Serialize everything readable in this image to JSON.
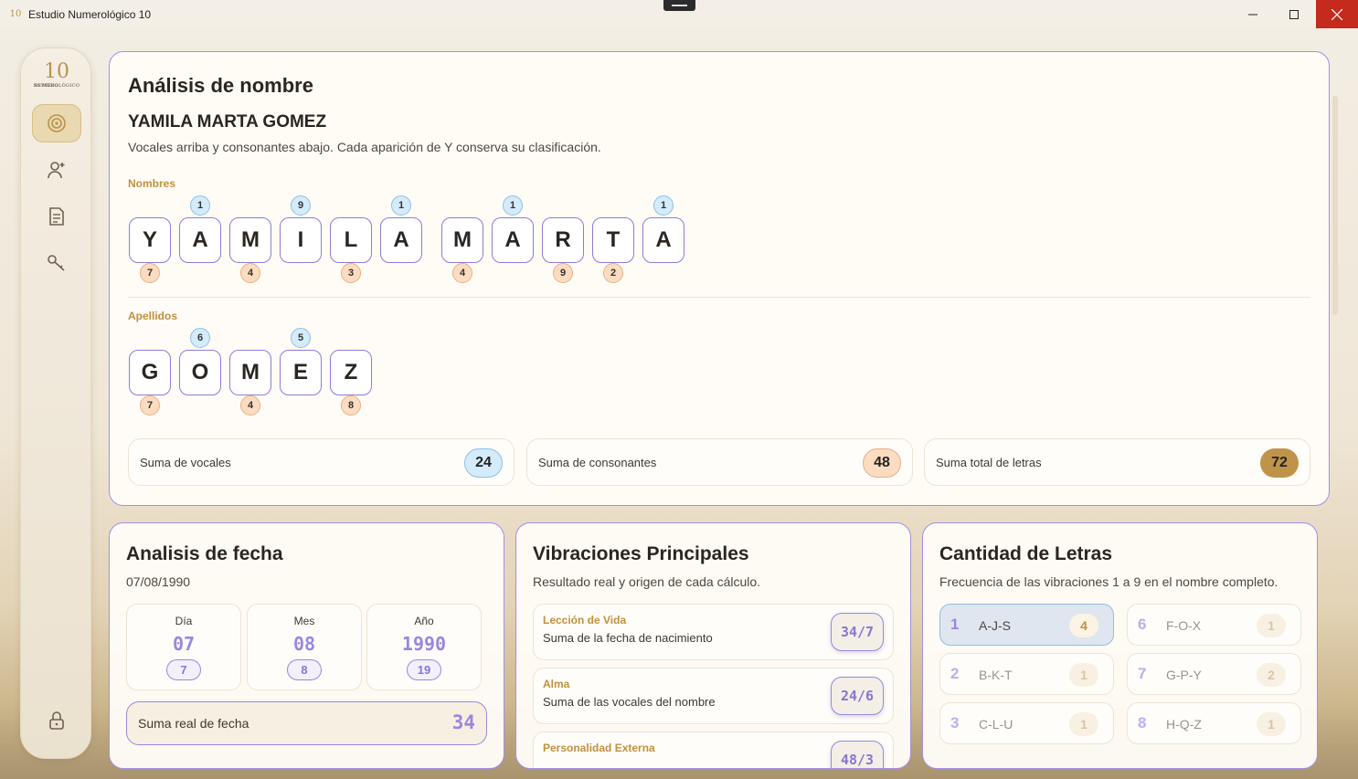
{
  "window": {
    "title": "Estudio Numerológico 10",
    "logo_text": "EN 10"
  },
  "sidebar": {
    "logo": {
      "num": "10",
      "line1": "ESTUDIO",
      "line2": "NUMEROLÓGICO"
    },
    "items": [
      {
        "name": "numerology",
        "icon": "numerology-icon",
        "active": true
      },
      {
        "name": "clients",
        "icon": "user-add-icon",
        "active": false
      },
      {
        "name": "reports",
        "icon": "document-icon",
        "active": false
      },
      {
        "name": "keys",
        "icon": "key-icon",
        "active": false
      }
    ],
    "lock_icon": "lock-icon"
  },
  "name_analysis": {
    "title": "Análisis de nombre",
    "full_name": "YAMILA MARTA GOMEZ",
    "description": "Vocales arriba y consonantes abajo. Cada aparición de Y conserva su clasificación.",
    "nombres_label": "Nombres",
    "apellidos_label": "Apellidos",
    "nombres": [
      {
        "letter": "Y",
        "vowel": null,
        "consonant": "7"
      },
      {
        "letter": "A",
        "vowel": "1",
        "consonant": null
      },
      {
        "letter": "M",
        "vowel": null,
        "consonant": "4"
      },
      {
        "letter": "I",
        "vowel": "9",
        "consonant": null
      },
      {
        "letter": "L",
        "vowel": null,
        "consonant": "3"
      },
      {
        "letter": "A",
        "vowel": "1",
        "consonant": null
      },
      {
        "letter": "M",
        "vowel": null,
        "consonant": "4"
      },
      {
        "letter": "A",
        "vowel": "1",
        "consonant": null
      },
      {
        "letter": "R",
        "vowel": null,
        "consonant": "9"
      },
      {
        "letter": "T",
        "vowel": null,
        "consonant": "2"
      },
      {
        "letter": "A",
        "vowel": "1",
        "consonant": null
      }
    ],
    "apellidos": [
      {
        "letter": "G",
        "vowel": null,
        "consonant": "7"
      },
      {
        "letter": "O",
        "vowel": "6",
        "consonant": null
      },
      {
        "letter": "M",
        "vowel": null,
        "consonant": "4"
      },
      {
        "letter": "E",
        "vowel": "5",
        "consonant": null
      },
      {
        "letter": "Z",
        "vowel": null,
        "consonant": "8"
      }
    ],
    "sums": {
      "vowels_label": "Suma de vocales",
      "vowels_value": "24",
      "consonants_label": "Suma de consonantes",
      "consonants_value": "48",
      "total_label": "Suma total de letras",
      "total_value": "72"
    }
  },
  "date_analysis": {
    "title": "Analisis de fecha",
    "date": "07/08/1990",
    "parts": [
      {
        "label": "Día",
        "value": "07",
        "reduced": "7"
      },
      {
        "label": "Mes",
        "value": "08",
        "reduced": "8"
      },
      {
        "label": "Año",
        "value": "1990",
        "reduced": "19"
      }
    ],
    "real_sum_label": "Suma real de fecha",
    "real_sum_value": "34"
  },
  "vibrations": {
    "title": "Vibraciones Principales",
    "subtitle": "Resultado real y origen de cada cálculo.",
    "items": [
      {
        "title": "Lección de Vida",
        "desc": "Suma de la fecha de nacimiento",
        "value": "34/7"
      },
      {
        "title": "Alma",
        "desc": "Suma de las vocales del nombre",
        "value": "24/6"
      },
      {
        "title": "Personalidad Externa",
        "desc": "",
        "value": "48/3"
      }
    ]
  },
  "letter_count": {
    "title": "Cantidad de Letras",
    "subtitle": "Frecuencia de las vibraciones 1 a 9 en el nombre completo.",
    "items": [
      {
        "num": "1",
        "letters": "A-J-S",
        "count": "4"
      },
      {
        "num": "6",
        "letters": "F-O-X",
        "count": "1"
      },
      {
        "num": "2",
        "letters": "B-K-T",
        "count": "1"
      },
      {
        "num": "7",
        "letters": "G-P-Y",
        "count": "2"
      },
      {
        "num": "3",
        "letters": "C-L-U",
        "count": "1"
      },
      {
        "num": "8",
        "letters": "H-Q-Z",
        "count": "1"
      }
    ]
  },
  "colors": {
    "accent": "#9b86e0",
    "gold": "#c0903e",
    "vowel_bg": "#d4ebfb",
    "consonant_bg": "#fbdcc0",
    "total_bg": "#c09448"
  }
}
